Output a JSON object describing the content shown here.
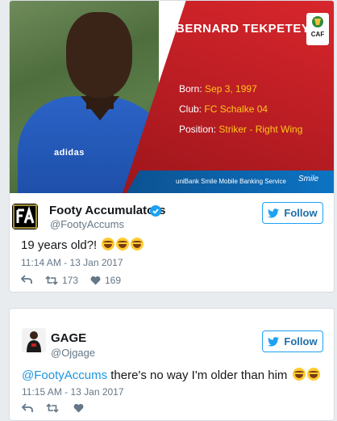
{
  "card": {
    "player_name": "BERNARD TEKPETEY",
    "facts": [
      {
        "label": "Born:",
        "value": "Sep 3, 1997"
      },
      {
        "label": "Club:",
        "value": "FC Schalke 04"
      },
      {
        "label": "Position:",
        "value": "Striker - Right Wing"
      }
    ],
    "banner": "uniBank  Smile Mobile Banking Service",
    "banner_logo": "Smile",
    "caf_logo": "CAF"
  },
  "tweets": [
    {
      "name": "Footy Accumulators",
      "handle": "@FootyAccums",
      "verified": true,
      "follow_label": "Follow",
      "text": "19 years old?!",
      "emoji_count": 3,
      "time": "11:14 AM - 13 Jan 2017",
      "retweets": "173",
      "likes": "169"
    },
    {
      "name": "GAGE",
      "handle": "@Ojgage",
      "verified": false,
      "follow_label": "Follow",
      "mention": "@FootyAccums",
      "text": " there's no way I'm older than him",
      "emoji_count": 2,
      "time": "11:15 AM - 13 Jan 2017"
    }
  ],
  "colors": {
    "accent": "#1da1f2",
    "link": "#1b95e0",
    "panel_red": "#c1201f",
    "fact_value": "#ffc61a"
  }
}
